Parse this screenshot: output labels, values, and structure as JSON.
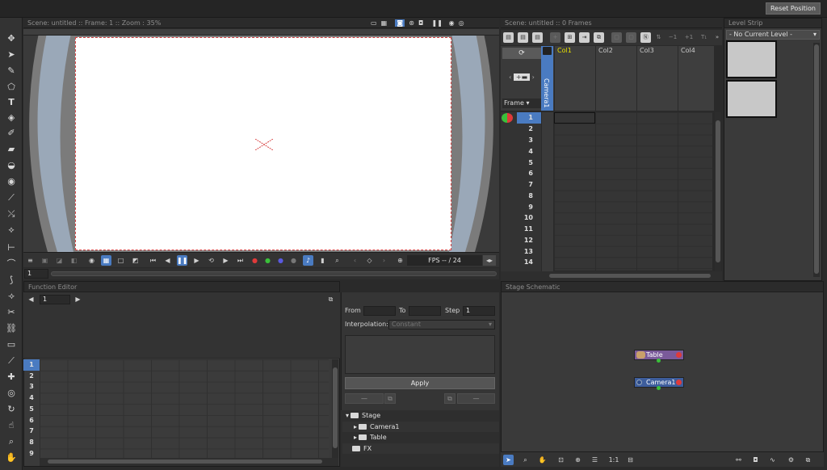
{
  "topbar": {
    "reset_label": "Reset Position"
  },
  "viewer": {
    "header": "Scene: untitled  ::  Frame: 1  ::  Zoom : 35%",
    "fps_label": "FPS -- / 24",
    "frame_value": "1"
  },
  "xsheet": {
    "header": "Scene: untitled  ::  0 Frames",
    "frame_label": "Frame",
    "camera_label": "Camera1",
    "columns": [
      "Col1",
      "Col2",
      "Col3",
      "Col4"
    ],
    "rows": [
      "1",
      "2",
      "3",
      "4",
      "5",
      "6",
      "7",
      "8",
      "9",
      "10",
      "11",
      "12",
      "13",
      "14"
    ],
    "toolbar_labels": {
      "minus1": "−1",
      "plus1": "+1",
      "more": "»"
    }
  },
  "level_strip": {
    "title": "Level Strip",
    "current_level": "- No Current Level -"
  },
  "function_editor": {
    "title": "Function Editor",
    "frame_value": "1",
    "from_label": "From",
    "to_label": "To",
    "step_label": "Step",
    "step_value": "1",
    "interpolation_label": "Interpolation:",
    "interpolation_value": "Constant",
    "apply_label": "Apply",
    "rows": [
      "1",
      "2",
      "3",
      "4",
      "5",
      "6",
      "7",
      "8",
      "9"
    ],
    "tree": {
      "stage": "Stage",
      "camera": "Camera1",
      "table": "Table",
      "fx": "FX"
    }
  },
  "schematic": {
    "title": "Stage Schematic",
    "nodes": {
      "table": "Table",
      "camera": "Camera1"
    },
    "zoom_label": "1:1"
  },
  "colors": {
    "accent": "#4a7bc1",
    "table_node": "#7a5a9a",
    "camera_node": "#3d5d9c",
    "col1_text": "#e8e000"
  }
}
